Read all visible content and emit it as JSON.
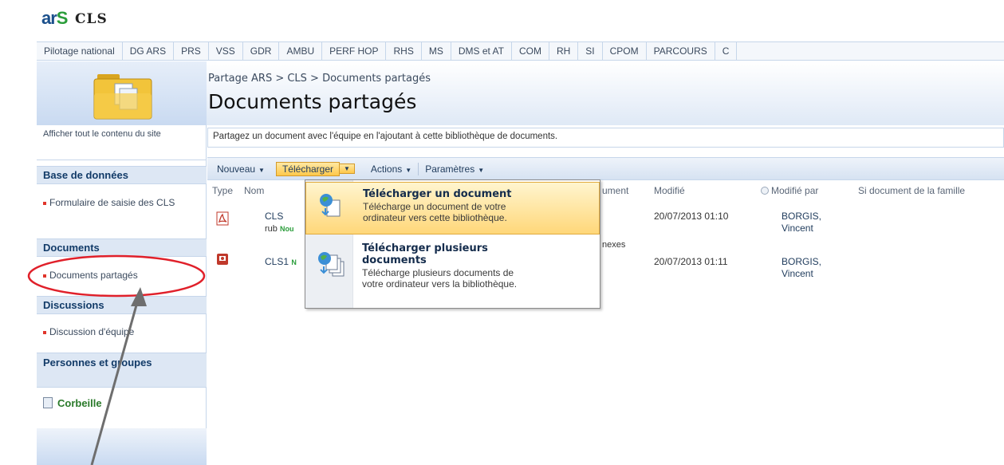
{
  "site": {
    "logo_text": "ar",
    "logo_s": "S",
    "name": "CLS"
  },
  "tabs": [
    "Pilotage national",
    "DG ARS",
    "PRS",
    "VSS",
    "GDR",
    "AMBU",
    "PERF HOP",
    "RHS",
    "MS",
    "DMS et AT",
    "COM",
    "RH",
    "SI",
    "CPOM",
    "PARCOURS",
    "C"
  ],
  "sidebar": {
    "view_all": "Afficher tout le contenu du site",
    "sections": [
      {
        "header": "Base de données",
        "items": [
          "Formulaire de saisie des CLS"
        ]
      },
      {
        "header": "Documents",
        "items": [
          "Documents partagés"
        ]
      },
      {
        "header": "Discussions",
        "items": [
          "Discussion d'équipe"
        ]
      },
      {
        "header": "Personnes et groupes",
        "items": []
      }
    ],
    "recycle": "Corbeille"
  },
  "main": {
    "breadcrumb": "Partage ARS > CLS > Documents partagés",
    "title": "Documents partagés",
    "description": "Partagez un document avec l'équipe en l'ajoutant à cette bibliothèque de documents."
  },
  "toolbar": {
    "new": "Nouveau",
    "upload": "Télécharger",
    "actions": "Actions",
    "settings": "Paramètres"
  },
  "columns": {
    "type": "Type",
    "name": "Nom",
    "doc_partial": "ument",
    "modified": "Modifié",
    "modified_by": "Modifié par",
    "family": "Si document de la famille"
  },
  "rows": [
    {
      "name": "CLS",
      "sub": "rub",
      "badge": "Nou",
      "extra": "nexes",
      "modified": "20/07/2013 01:10",
      "by_last": "BORGIS,",
      "by_first": "Vincent",
      "icon": "pdf-icon"
    },
    {
      "name": "CLS1",
      "badge": "N",
      "modified": "20/07/2013 01:11",
      "by_last": "BORGIS,",
      "by_first": "Vincent",
      "icon": "ppt-icon"
    }
  ],
  "dropdown": {
    "items": [
      {
        "title": "Télécharger un document",
        "desc1": "Télécharge un document de votre",
        "desc2": "ordinateur vers cette bibliothèque."
      },
      {
        "title1": "Télécharger plusieurs",
        "title2": "documents",
        "desc1": "Télécharge plusieurs documents de",
        "desc2": "votre ordinateur vers la bibliothèque."
      }
    ]
  },
  "colors": {
    "accent": "#1a4f8b",
    "highlight": "#ffc84a",
    "annotation": "#e0202a",
    "arrow": "#6e6e6e"
  }
}
